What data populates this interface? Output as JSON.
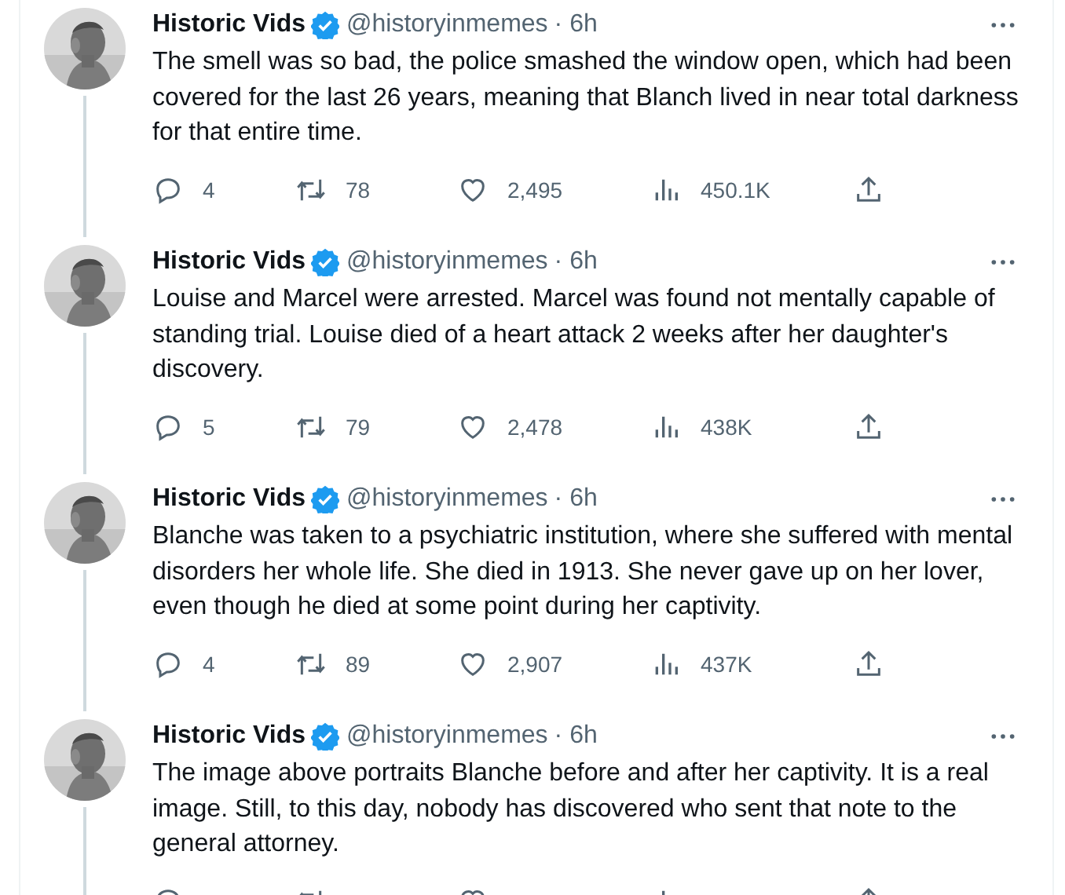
{
  "tweets": [
    {
      "author": "Historic Vids",
      "verified": true,
      "handle": "@historyinmemes",
      "time": "· 6h",
      "text": "The smell was so bad, the police smashed the window open, which had been covered for the last 26 years, meaning that Blanch lived in near total darkness for that entire time.",
      "replies": "4",
      "reposts": "78",
      "likes": "2,495",
      "views": "450.1K"
    },
    {
      "author": "Historic Vids",
      "verified": true,
      "handle": "@historyinmemes",
      "time": "· 6h",
      "text": "Louise and Marcel were arrested. Marcel was found not mentally capable of standing trial. Louise died of a heart attack 2 weeks after her daughter's discovery.",
      "replies": "5",
      "reposts": "79",
      "likes": "2,478",
      "views": "438K"
    },
    {
      "author": "Historic Vids",
      "verified": true,
      "handle": "@historyinmemes",
      "time": "· 6h",
      "text": "Blanche was taken to a psychiatric institution, where she suffered with mental disorders her whole life. She died in 1913. She never gave up on her lover, even though he died at some point during her captivity.",
      "replies": "4",
      "reposts": "89",
      "likes": "2,907",
      "views": "437K"
    },
    {
      "author": "Historic Vids",
      "verified": true,
      "handle": "@historyinmemes",
      "time": "· 6h",
      "text": "The image above portraits Blanche before and after her captivity. It is a real image. Still, to this day, nobody has discovered who sent that note to the general attorney."
    }
  ]
}
